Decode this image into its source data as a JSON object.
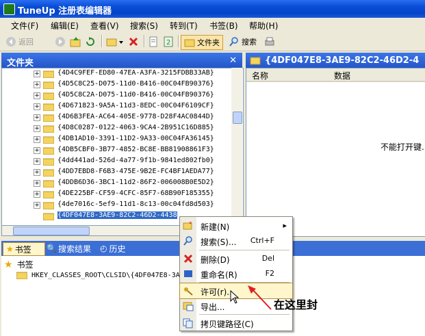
{
  "window": {
    "title": "TuneUp 注册表编辑器"
  },
  "menubar": [
    "文件(F)",
    "编辑(E)",
    "查看(V)",
    "搜索(S)",
    "转到(T)",
    "书签(B)",
    "帮助(H)"
  ],
  "toolbar": {
    "back_label": "返回",
    "folders_label": "文件夹",
    "search_label": "搜索"
  },
  "left_panel": {
    "title": "文件夹",
    "rows": [
      {
        "key": "{4D4C9FEF-ED80-47EA-A3FA-3215FDBB33AB}",
        "expandable": true
      },
      {
        "key": "{4D5C8C25-D075-11d0-B416-00C04FB90376}",
        "expandable": true
      },
      {
        "key": "{4D5C8C2A-D075-11d0-B416-00C04FB90376}",
        "expandable": true
      },
      {
        "key": "{4D671823-9A5A-11d3-8EDC-00C04F6109CF}",
        "expandable": true
      },
      {
        "key": "{4D6B3FEA-AC64-405E-9778-D28F4AC0844D}",
        "expandable": true
      },
      {
        "key": "{4D8C0287-0122-4063-9CA4-2B951C16D885}",
        "expandable": true
      },
      {
        "key": "{4DB1AD10-3391-11D2-9A33-00C04FA36145}",
        "expandable": true
      },
      {
        "key": "{4DB5CBF0-3B77-4852-BC8E-BB81908861F3}",
        "expandable": true
      },
      {
        "key": "{4dd441ad-526d-4a77-9f1b-9841ed802fb0}",
        "expandable": true
      },
      {
        "key": "{4DD7EBD8-F6B3-475E-9B2E-FC4BF1AEDA77}",
        "expandable": true
      },
      {
        "key": "{4DDB6D36-3BC1-11d2-86F2-006008B0E5D2}",
        "expandable": true
      },
      {
        "key": "{4DE225BF-CF59-4CFC-85F7-68B90F185355}",
        "expandable": true
      },
      {
        "key": "{4de7016c-5ef9-11d1-8c13-00c04fd8d503}",
        "expandable": true
      },
      {
        "key": "{4DF047E8-3AE9-82C2-46D2-4438",
        "expandable": false
      }
    ]
  },
  "right_panel": {
    "title": "{4DF047E8-3AE9-82C2-46D2-4",
    "columns": [
      "名称",
      "数据"
    ],
    "message": "不能打开键."
  },
  "bottom_tabs": [
    "书签",
    "搜索结果",
    "历史"
  ],
  "bookmarks": {
    "root": "书签",
    "item": "HKEY_CLASSES_ROOT\\CLSID\\{4DF047E8-3A"
  },
  "context_menu": {
    "items": [
      {
        "label": "新建(N)",
        "shortcut": "",
        "submenu": true,
        "icon": "new-key-icon"
      },
      {
        "label": "搜索(S)...",
        "shortcut": "Ctrl+F",
        "submenu": false,
        "icon": "search-icon"
      },
      {
        "label": "删除(D)",
        "shortcut": "Del",
        "submenu": false,
        "icon": "delete-icon"
      },
      {
        "label": "重命名(R)",
        "shortcut": "F2",
        "submenu": false,
        "icon": "rename-icon"
      },
      {
        "label": "许可(r)...",
        "shortcut": "",
        "submenu": false,
        "icon": "key-icon",
        "highlighted": true
      },
      {
        "label": "导出...",
        "shortcut": "",
        "submenu": false,
        "icon": "export-icon"
      },
      {
        "label": "拷贝键路径(C)",
        "shortcut": "",
        "submenu": false,
        "icon": "copy-path-icon"
      }
    ]
  },
  "annotation": {
    "text": "在这里封"
  },
  "colors": {
    "title_blue": "#0a4fd8",
    "selection": "#316ac5",
    "highlight": "#fff6cc",
    "annotation_arrow": "#e02020"
  }
}
